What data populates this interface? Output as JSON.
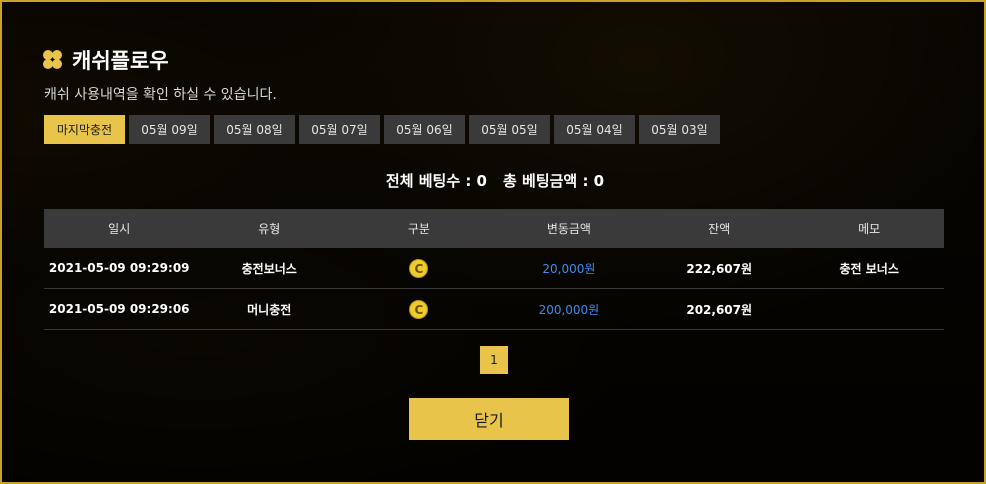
{
  "header": {
    "title": "캐쉬플로우",
    "subtitle": "캐쉬 사용내역을 확인 하실 수 있습니다."
  },
  "tabs": [
    {
      "label": "마지막충전",
      "active": true
    },
    {
      "label": "05월 09일",
      "active": false
    },
    {
      "label": "05월 08일",
      "active": false
    },
    {
      "label": "05월 07일",
      "active": false
    },
    {
      "label": "05월 06일",
      "active": false
    },
    {
      "label": "05월 05일",
      "active": false
    },
    {
      "label": "05월 04일",
      "active": false
    },
    {
      "label": "05월 03일",
      "active": false
    }
  ],
  "summary": {
    "bet_count": "전체 베팅수 : 0",
    "bet_amount": "총 베팅금액 : 0"
  },
  "table": {
    "columns": [
      "일시",
      "유형",
      "구분",
      "변동금액",
      "잔액",
      "메모"
    ],
    "rows": [
      {
        "datetime": "2021-05-09 09:29:09",
        "type": "충전보너스",
        "category_icon": "coin-icon",
        "coin_letter": "C",
        "change": "20,000원",
        "balance": "222,607원",
        "memo": "충전 보너스"
      },
      {
        "datetime": "2021-05-09 09:29:06",
        "type": "머니충전",
        "category_icon": "coin-icon",
        "coin_letter": "C",
        "change": "200,000원",
        "balance": "202,607원",
        "memo": ""
      }
    ]
  },
  "pagination": {
    "current": "1"
  },
  "close_label": "닫기",
  "colors": {
    "accent": "#e8c54a",
    "amount": "#3d8df0",
    "border": "#c9a227"
  }
}
